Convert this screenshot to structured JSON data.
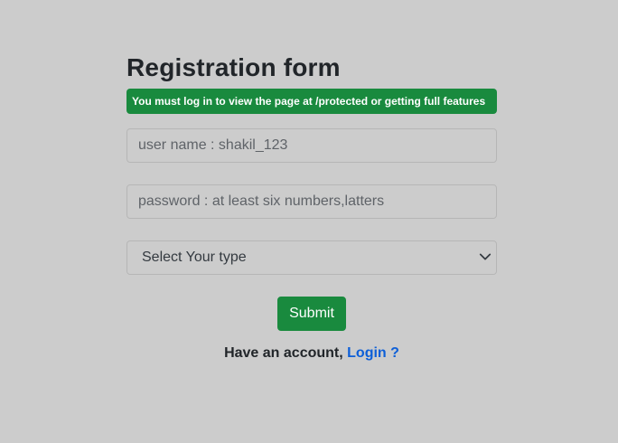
{
  "form": {
    "title": "Registration form",
    "alert_text": "You must log in to view the page at /protected or getting full features",
    "username_placeholder": "user name : shakil_123",
    "password_placeholder": "password : at least six numbers,latters",
    "select_value": "Select Your type",
    "submit_label": "Submit",
    "account_text": "Have an account,",
    "login_link": "Login ?"
  },
  "colors": {
    "background": "#cccccc",
    "success": "#198a3e",
    "link": "#0d5fd8"
  },
  "icons": {
    "select_chevron": "chevron-down-icon"
  }
}
